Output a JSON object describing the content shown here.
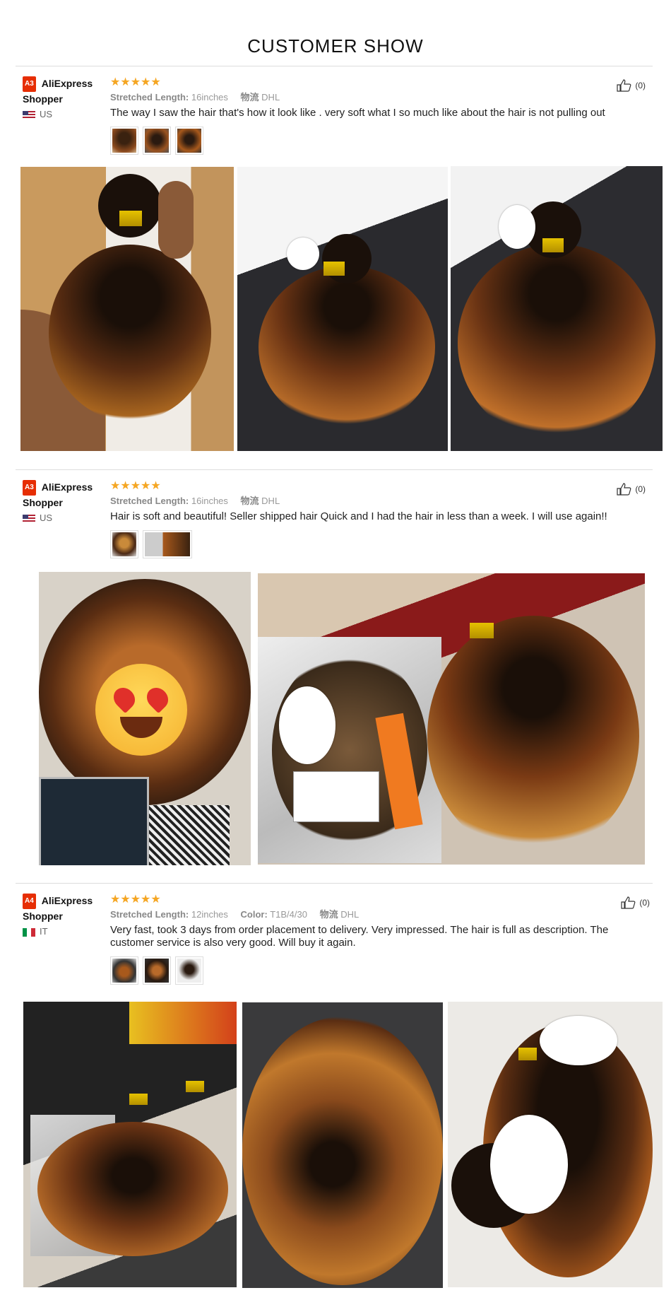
{
  "page": {
    "title": "CUSTOMER SHOW"
  },
  "reviews": [
    {
      "badge": "A3",
      "name": "AliExpress Shopper",
      "country": "US",
      "stars": "★★★★★",
      "meta": [
        {
          "label": "Stretched Length:",
          "value": "16inches"
        },
        {
          "label": "物流",
          "value": "DHL"
        }
      ],
      "comment": "The way I saw the hair that's how it look like . very soft what I so much like about the hair is not pulling out",
      "helpful": "(0)"
    },
    {
      "badge": "A3",
      "name": "AliExpress Shopper",
      "country": "US",
      "stars": "★★★★★",
      "meta": [
        {
          "label": "Stretched Length:",
          "value": "16inches"
        },
        {
          "label": "物流",
          "value": "DHL"
        }
      ],
      "comment": "Hair is soft and beautiful! Seller shipped hair Quick and I had the hair in less than a week. I will use again!!",
      "helpful": "(0)"
    },
    {
      "badge": "A4",
      "name": "AliExpress Shopper",
      "country": "IT",
      "stars": "★★★★★",
      "meta": [
        {
          "label": "Stretched Length:",
          "value": "12inches"
        },
        {
          "label": "Color:",
          "value": "T1B/4/30"
        },
        {
          "label": "物流",
          "value": "DHL"
        }
      ],
      "comment": "Very fast, took 3 days from order placement to delivery. Very impressed. The hair is full as description. The customer service is also very good. Will buy it again.",
      "helpful": "(0)"
    }
  ],
  "colors": {
    "star": "#f5a623",
    "badge": "#e62e04",
    "hair_dark": "#2a1a10",
    "hair_ombre": "#a8591c"
  }
}
